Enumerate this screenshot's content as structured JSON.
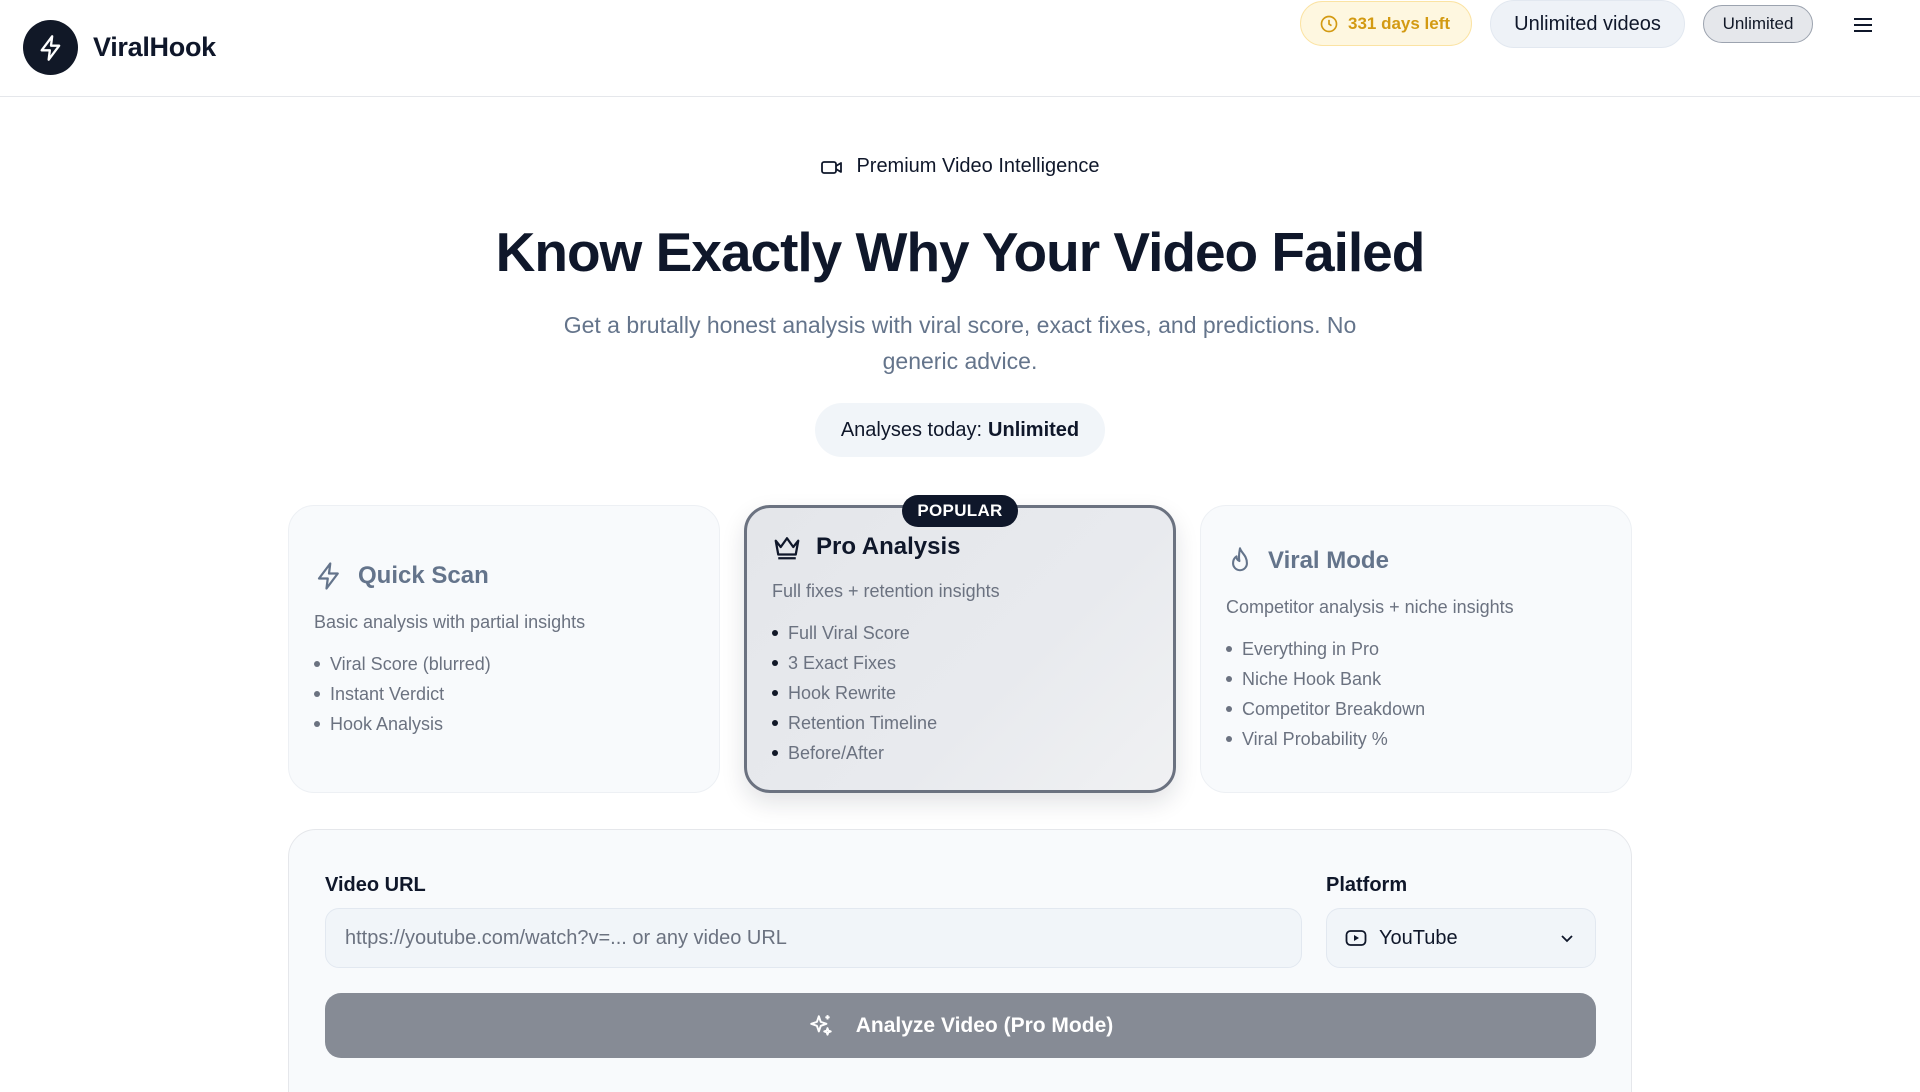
{
  "header": {
    "app_name": "ViralHook",
    "days_left": "331 days left",
    "videos_label": "Unlimited videos",
    "plan_badge": "Unlimited"
  },
  "hero": {
    "eyebrow": "Premium Video Intelligence",
    "title": "Know Exactly Why Your Video Failed",
    "subtitle": "Get a brutally honest analysis with viral score, exact fixes, and predictions. No generic advice.",
    "counter_label": "Analyses today:",
    "counter_value": "Unlimited"
  },
  "plans": [
    {
      "title": "Quick Scan",
      "icon": "lightning-icon",
      "description": "Basic analysis with partial insights",
      "features": [
        "Viral Score (blurred)",
        "Instant Verdict",
        "Hook Analysis"
      ]
    },
    {
      "title": "Pro Analysis",
      "icon": "crown-icon",
      "badge": "POPULAR",
      "selected": true,
      "description": "Full fixes + retention insights",
      "features": [
        "Full Viral Score",
        "3 Exact Fixes",
        "Hook Rewrite",
        "Retention Timeline",
        "Before/After"
      ]
    },
    {
      "title": "Viral Mode",
      "icon": "flame-icon",
      "description": "Competitor analysis + niche insights",
      "features": [
        "Everything in Pro",
        "Niche Hook Bank",
        "Competitor Breakdown",
        "Viral Probability %"
      ]
    }
  ],
  "form": {
    "url_label": "Video URL",
    "url_placeholder": "https://youtube.com/watch?v=... or any video URL",
    "url_value": "",
    "platform_label": "Platform",
    "platform_value": "YouTube",
    "submit_label": "Analyze Video (Pro Mode)"
  },
  "colors": {
    "brand_dark": "#0f172a",
    "days_pill_text": "#d39a12",
    "days_pill_bg": "#fef7e0",
    "button_disabled": "#868b95",
    "muted_text": "#64748b"
  }
}
